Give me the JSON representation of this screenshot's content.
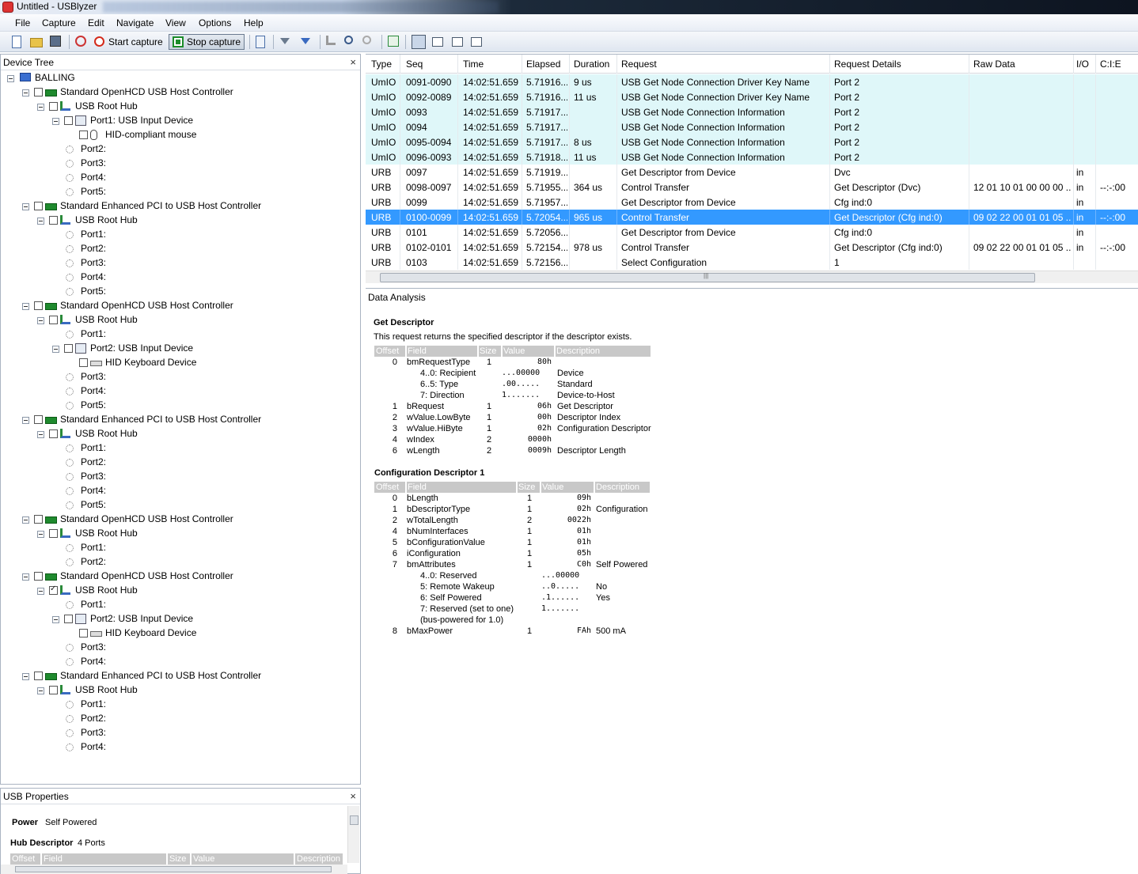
{
  "window": {
    "title": "Untitled - USBlyzer"
  },
  "menu": [
    "File",
    "Capture",
    "Edit",
    "Navigate",
    "View",
    "Options",
    "Help"
  ],
  "toolbar": {
    "start_label": "Start capture",
    "stop_label": "Stop capture"
  },
  "device_tree": {
    "title": "Device Tree",
    "close": "×",
    "rows": [
      {
        "label": "BALLING",
        "icon": "computer-icon",
        "level": 0,
        "check": false,
        "nochk": true
      },
      {
        "label": "Standard OpenHCD USB Host Controller",
        "icon": "controller-icon",
        "level": 1
      },
      {
        "label": "USB Root Hub",
        "icon": "hub-icon",
        "level": 2
      },
      {
        "label": "Port1: USB Input Device",
        "icon": "device-icon",
        "level": 3
      },
      {
        "label": "HID-compliant mouse",
        "icon": "mouse-icon",
        "level": 4
      },
      {
        "label": "Port2:",
        "icon": "port-icon",
        "level": 3,
        "nochk": true
      },
      {
        "label": "Port3:",
        "icon": "port-icon",
        "level": 3,
        "nochk": true
      },
      {
        "label": "Port4:",
        "icon": "port-icon",
        "level": 3,
        "nochk": true
      },
      {
        "label": "Port5:",
        "icon": "port-icon",
        "level": 3,
        "nochk": true
      },
      {
        "label": "Standard Enhanced PCI to USB Host Controller",
        "icon": "controller-icon",
        "level": 1
      },
      {
        "label": "USB Root Hub",
        "icon": "hub-icon",
        "level": 2
      },
      {
        "label": "Port1:",
        "icon": "port-icon",
        "level": 3,
        "nochk": true
      },
      {
        "label": "Port2:",
        "icon": "port-icon",
        "level": 3,
        "nochk": true
      },
      {
        "label": "Port3:",
        "icon": "port-icon",
        "level": 3,
        "nochk": true
      },
      {
        "label": "Port4:",
        "icon": "port-icon",
        "level": 3,
        "nochk": true
      },
      {
        "label": "Port5:",
        "icon": "port-icon",
        "level": 3,
        "nochk": true
      },
      {
        "label": "Standard OpenHCD USB Host Controller",
        "icon": "controller-icon",
        "level": 1
      },
      {
        "label": "USB Root Hub",
        "icon": "hub-icon",
        "level": 2
      },
      {
        "label": "Port1:",
        "icon": "port-icon",
        "level": 3,
        "nochk": true
      },
      {
        "label": "Port2: USB Input Device",
        "icon": "device-icon",
        "level": 3
      },
      {
        "label": "HID Keyboard Device",
        "icon": "keyboard-icon",
        "level": 4
      },
      {
        "label": "Port3:",
        "icon": "port-icon",
        "level": 3,
        "nochk": true
      },
      {
        "label": "Port4:",
        "icon": "port-icon",
        "level": 3,
        "nochk": true
      },
      {
        "label": "Port5:",
        "icon": "port-icon",
        "level": 3,
        "nochk": true
      },
      {
        "label": "Standard Enhanced PCI to USB Host Controller",
        "icon": "controller-icon",
        "level": 1
      },
      {
        "label": "USB Root Hub",
        "icon": "hub-icon",
        "level": 2
      },
      {
        "label": "Port1:",
        "icon": "port-icon",
        "level": 3,
        "nochk": true
      },
      {
        "label": "Port2:",
        "icon": "port-icon",
        "level": 3,
        "nochk": true
      },
      {
        "label": "Port3:",
        "icon": "port-icon",
        "level": 3,
        "nochk": true
      },
      {
        "label": "Port4:",
        "icon": "port-icon",
        "level": 3,
        "nochk": true
      },
      {
        "label": "Port5:",
        "icon": "port-icon",
        "level": 3,
        "nochk": true
      },
      {
        "label": "Standard OpenHCD USB Host Controller",
        "icon": "controller-icon",
        "level": 1
      },
      {
        "label": "USB Root Hub",
        "icon": "hub-icon",
        "level": 2
      },
      {
        "label": "Port1:",
        "icon": "port-icon",
        "level": 3,
        "nochk": true
      },
      {
        "label": "Port2:",
        "icon": "port-icon",
        "level": 3,
        "nochk": true
      },
      {
        "label": "Standard OpenHCD USB Host Controller",
        "icon": "controller-icon",
        "level": 1
      },
      {
        "label": "USB Root Hub",
        "icon": "hub-icon",
        "level": 2,
        "check": true
      },
      {
        "label": "Port1:",
        "icon": "port-icon",
        "level": 3,
        "nochk": true
      },
      {
        "label": "Port2: USB Input Device",
        "icon": "device-icon",
        "level": 3
      },
      {
        "label": "HID Keyboard Device",
        "icon": "keyboard-icon",
        "level": 4
      },
      {
        "label": "Port3:",
        "icon": "port-icon",
        "level": 3,
        "nochk": true
      },
      {
        "label": "Port4:",
        "icon": "port-icon",
        "level": 3,
        "nochk": true
      },
      {
        "label": "Standard Enhanced PCI to USB Host Controller",
        "icon": "controller-icon",
        "level": 1
      },
      {
        "label": "USB Root Hub",
        "icon": "hub-icon",
        "level": 2
      },
      {
        "label": "Port1:",
        "icon": "port-icon",
        "level": 3,
        "nochk": true
      },
      {
        "label": "Port2:",
        "icon": "port-icon",
        "level": 3,
        "nochk": true
      },
      {
        "label": "Port3:",
        "icon": "port-icon",
        "level": 3,
        "nochk": true
      },
      {
        "label": "Port4:",
        "icon": "port-icon",
        "level": 3,
        "nochk": true
      }
    ]
  },
  "usb_properties": {
    "title": "USB Properties",
    "close": "×",
    "power_label": "Power",
    "power_value": "Self Powered",
    "hub_label": "Hub Descriptor",
    "hub_value": "4 Ports",
    "columns": [
      "Offset",
      "Field",
      "Size",
      "Value",
      "Description"
    ]
  },
  "grid": {
    "columns": [
      "Type",
      "Seq",
      "Time",
      "Elapsed",
      "Duration",
      "Request",
      "Request Details",
      "Raw Data",
      "I/O",
      "C:I:E"
    ],
    "rows": [
      {
        "type": "UmIO",
        "seq": "0091-0090",
        "time": "14:02:51.659",
        "elapsed": "5.71916...",
        "duration": "9 us",
        "request": "USB Get Node Connection Driver Key Name",
        "details": "Port 2",
        "raw": "",
        "io": "",
        "cie": "",
        "kind": "umio"
      },
      {
        "type": "UmIO",
        "seq": "0092-0089",
        "time": "14:02:51.659",
        "elapsed": "5.71916...",
        "duration": "11 us",
        "request": "USB Get Node Connection Driver Key Name",
        "details": "Port 2",
        "raw": "",
        "io": "",
        "cie": "",
        "kind": "umio"
      },
      {
        "type": "UmIO",
        "seq": "0093",
        "time": "14:02:51.659",
        "elapsed": "5.71917...",
        "duration": "",
        "request": "USB Get Node Connection Information",
        "details": "Port 2",
        "raw": "",
        "io": "",
        "cie": "",
        "kind": "umio"
      },
      {
        "type": "UmIO",
        "seq": "0094",
        "time": "14:02:51.659",
        "elapsed": "5.71917...",
        "duration": "",
        "request": "USB Get Node Connection Information",
        "details": "Port 2",
        "raw": "",
        "io": "",
        "cie": "",
        "kind": "umio"
      },
      {
        "type": "UmIO",
        "seq": "0095-0094",
        "time": "14:02:51.659",
        "elapsed": "5.71917...",
        "duration": "8 us",
        "request": "USB Get Node Connection Information",
        "details": "Port 2",
        "raw": "",
        "io": "",
        "cie": "",
        "kind": "umio"
      },
      {
        "type": "UmIO",
        "seq": "0096-0093",
        "time": "14:02:51.659",
        "elapsed": "5.71918...",
        "duration": "11 us",
        "request": "USB Get Node Connection Information",
        "details": "Port 2",
        "raw": "",
        "io": "",
        "cie": "",
        "kind": "umio"
      },
      {
        "type": "URB",
        "seq": "0097",
        "time": "14:02:51.659",
        "elapsed": "5.71919...",
        "duration": "",
        "request": "Get Descriptor from Device",
        "details": "Dvc",
        "raw": "",
        "io": "in",
        "cie": "",
        "kind": "urb"
      },
      {
        "type": "URB",
        "seq": "0098-0097",
        "time": "14:02:51.659",
        "elapsed": "5.71955...",
        "duration": "364 us",
        "request": "Control Transfer",
        "details": "Get Descriptor (Dvc)",
        "raw": "12 01 10 01 00 00 00 ...",
        "io": "in",
        "cie": "--:-:00",
        "kind": "urb"
      },
      {
        "type": "URB",
        "seq": "0099",
        "time": "14:02:51.659",
        "elapsed": "5.71957...",
        "duration": "",
        "request": "Get Descriptor from Device",
        "details": "Cfg ind:0",
        "raw": "",
        "io": "in",
        "cie": "",
        "kind": "urb"
      },
      {
        "type": "URB",
        "seq": "0100-0099",
        "time": "14:02:51.659",
        "elapsed": "5.72054...",
        "duration": "965 us",
        "request": "Control Transfer",
        "details": "Get Descriptor (Cfg ind:0)",
        "raw": "09 02 22 00 01 01 05 ...",
        "io": "in",
        "cie": "--:-:00",
        "kind": "sel"
      },
      {
        "type": "URB",
        "seq": "0101",
        "time": "14:02:51.659",
        "elapsed": "5.72056...",
        "duration": "",
        "request": "Get Descriptor from Device",
        "details": "Cfg ind:0",
        "raw": "",
        "io": "in",
        "cie": "",
        "kind": "urb"
      },
      {
        "type": "URB",
        "seq": "0102-0101",
        "time": "14:02:51.659",
        "elapsed": "5.72154...",
        "duration": "978 us",
        "request": "Control Transfer",
        "details": "Get Descriptor (Cfg ind:0)",
        "raw": "09 02 22 00 01 01 05 ...",
        "io": "in",
        "cie": "--:-:00",
        "kind": "urb"
      },
      {
        "type": "URB",
        "seq": "0103",
        "time": "14:02:51.659",
        "elapsed": "5.72156...",
        "duration": "",
        "request": "Select Configuration",
        "details": "1",
        "raw": "",
        "io": "",
        "cie": "",
        "kind": "urb"
      }
    ]
  },
  "analysis": {
    "title": "Data Analysis",
    "section1_title": "Get Descriptor",
    "section1_desc": "This request returns the specified descriptor if the descriptor exists.",
    "cols": [
      "Offset",
      "Field",
      "Size",
      "Value",
      "Description"
    ],
    "t1": [
      {
        "off": "0",
        "field": "bmRequestType",
        "size": "1",
        "value": "80h",
        "desc": "",
        "sub": false
      },
      {
        "off": "",
        "field": "4..0: Recipient",
        "size": "",
        "value": "...00000",
        "desc": "Device",
        "sub": true
      },
      {
        "off": "",
        "field": "6..5: Type",
        "size": "",
        "value": ".00.....",
        "desc": "Standard",
        "sub": true
      },
      {
        "off": "",
        "field": "7: Direction",
        "size": "",
        "value": "1.......",
        "desc": "Device-to-Host",
        "sub": true
      },
      {
        "off": "1",
        "field": "bRequest",
        "size": "1",
        "value": "06h",
        "desc": "Get Descriptor",
        "sub": false
      },
      {
        "off": "2",
        "field": "wValue.LowByte",
        "size": "1",
        "value": "00h",
        "desc": "Descriptor Index",
        "sub": false
      },
      {
        "off": "3",
        "field": "wValue.HiByte",
        "size": "1",
        "value": "02h",
        "desc": "Configuration Descriptor",
        "sub": false
      },
      {
        "off": "4",
        "field": "wIndex",
        "size": "2",
        "value": "0000h",
        "desc": "",
        "sub": false
      },
      {
        "off": "6",
        "field": "wLength",
        "size": "2",
        "value": "0009h",
        "desc": "Descriptor Length",
        "sub": false
      }
    ],
    "section2_title": "Configuration Descriptor 1",
    "t2": [
      {
        "off": "0",
        "field": "bLength",
        "size": "1",
        "value": "09h",
        "desc": "",
        "sub": false
      },
      {
        "off": "1",
        "field": "bDescriptorType",
        "size": "1",
        "value": "02h",
        "desc": "Configuration",
        "sub": false
      },
      {
        "off": "2",
        "field": "wTotalLength",
        "size": "2",
        "value": "0022h",
        "desc": "",
        "sub": false
      },
      {
        "off": "4",
        "field": "bNumInterfaces",
        "size": "1",
        "value": "01h",
        "desc": "",
        "sub": false
      },
      {
        "off": "5",
        "field": "bConfigurationValue",
        "size": "1",
        "value": "01h",
        "desc": "",
        "sub": false
      },
      {
        "off": "6",
        "field": "iConfiguration",
        "size": "1",
        "value": "05h",
        "desc": "",
        "sub": false
      },
      {
        "off": "7",
        "field": "bmAttributes",
        "size": "1",
        "value": "C0h",
        "desc": "Self Powered",
        "sub": false
      },
      {
        "off": "",
        "field": "4..0: Reserved",
        "size": "",
        "value": "...00000",
        "desc": "",
        "sub": true
      },
      {
        "off": "",
        "field": "5: Remote Wakeup",
        "size": "",
        "value": "..0.....",
        "desc": "No",
        "sub": true
      },
      {
        "off": "",
        "field": "6: Self Powered",
        "size": "",
        "value": ".1......",
        "desc": "Yes",
        "sub": true
      },
      {
        "off": "",
        "field": "7: Reserved (set to one)",
        "size": "",
        "value": "1.......",
        "desc": "",
        "sub": true
      },
      {
        "off": "",
        "field": "(bus-powered for 1.0)",
        "size": "",
        "value": "",
        "desc": "",
        "sub": true
      },
      {
        "off": "8",
        "field": "bMaxPower",
        "size": "1",
        "value": "FAh",
        "desc": "500 mA",
        "sub": false
      }
    ]
  }
}
